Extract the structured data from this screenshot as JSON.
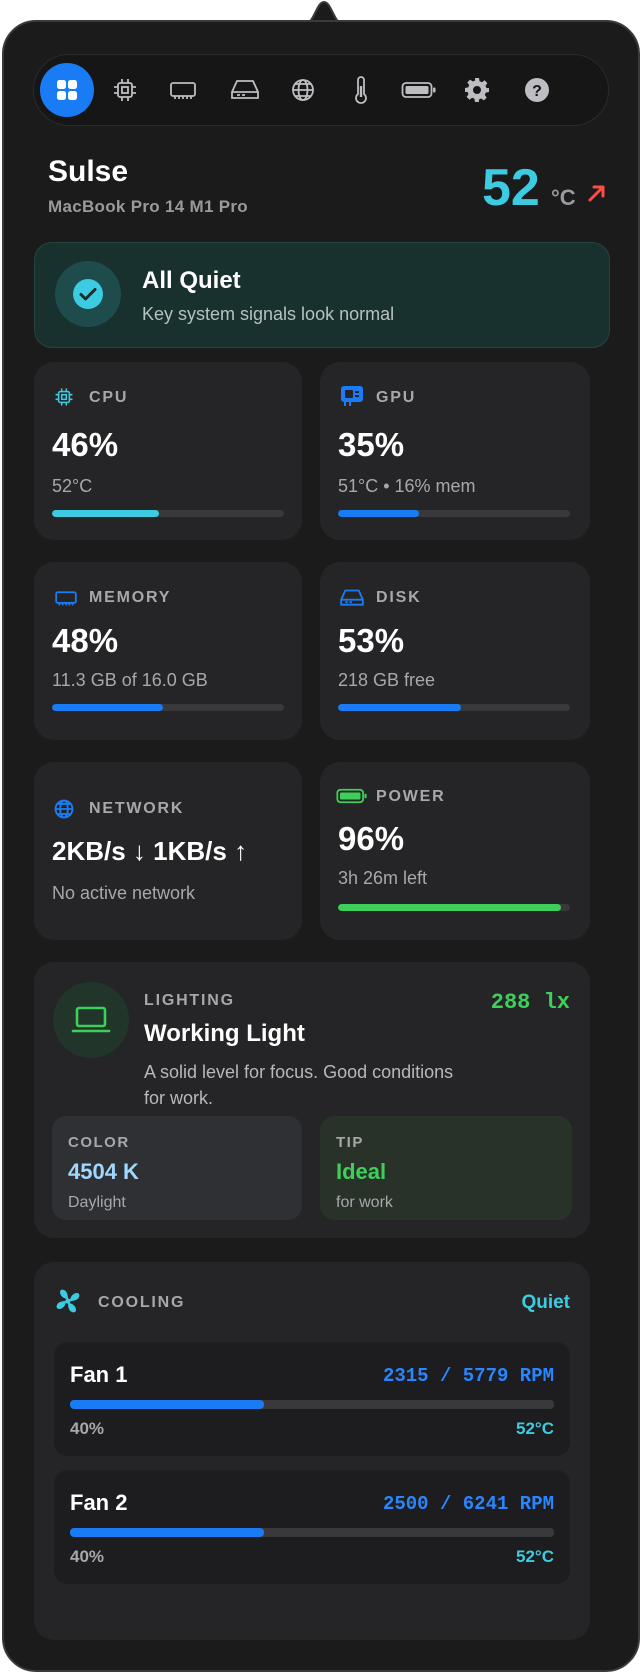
{
  "header": {
    "device_name": "Sulse",
    "model": "MacBook Pro 14 M1 Pro",
    "temperature": "52",
    "temp_unit": "°C"
  },
  "toolbar": {
    "tabs": [
      "dashboard-icon",
      "cpu-icon",
      "memory-icon",
      "disk-icon",
      "network-icon",
      "thermometer-icon",
      "battery-icon",
      "gear-icon",
      "help-icon"
    ],
    "active": 0
  },
  "status": {
    "title": "All Quiet",
    "subtitle": "Key system signals look normal"
  },
  "cards": {
    "cpu": {
      "label": "CPU",
      "value": "46%",
      "sub": "52°C",
      "level": 0.46,
      "color": "#3ccbe0"
    },
    "gpu": {
      "label": "GPU",
      "value": "35%",
      "sub": "51°C • 16% mem",
      "level": 0.35,
      "color": "#1a7cf5"
    },
    "memory": {
      "label": "MEMORY",
      "value": "48%",
      "sub": "11.3 GB of 16.0 GB",
      "level": 0.48,
      "color": "#1a7cf5"
    },
    "disk": {
      "label": "DISK",
      "value": "53%",
      "sub": "218 GB free",
      "level": 0.53,
      "color": "#1a7cf5"
    },
    "network": {
      "label": "NETWORK",
      "value": "2KB/s ↓ 1KB/s ↑",
      "sub": "No active network"
    },
    "power": {
      "label": "POWER",
      "value": "96%",
      "sub": "3h 26m left",
      "level": 0.96,
      "color": "#3ecf5a"
    }
  },
  "lighting": {
    "label": "LIGHTING",
    "lux": "288 lx",
    "title": "Working Light",
    "desc_line1": "A solid level for focus. Good conditions",
    "desc_line2": "for work.",
    "color": {
      "label": "COLOR",
      "value": "4504 K",
      "sub": "Daylight"
    },
    "tip": {
      "label": "TIP",
      "value": "Ideal",
      "sub": "for work"
    }
  },
  "cooling": {
    "label": "COOLING",
    "mode": "Quiet",
    "fans": [
      {
        "name": "Fan 1",
        "rpm": "2315 / 5779 RPM",
        "pct": "40%",
        "level": 0.4,
        "temp": "52°C"
      },
      {
        "name": "Fan 2",
        "rpm": "2500 / 6241 RPM",
        "pct": "40%",
        "level": 0.4,
        "temp": "52°C"
      }
    ]
  }
}
